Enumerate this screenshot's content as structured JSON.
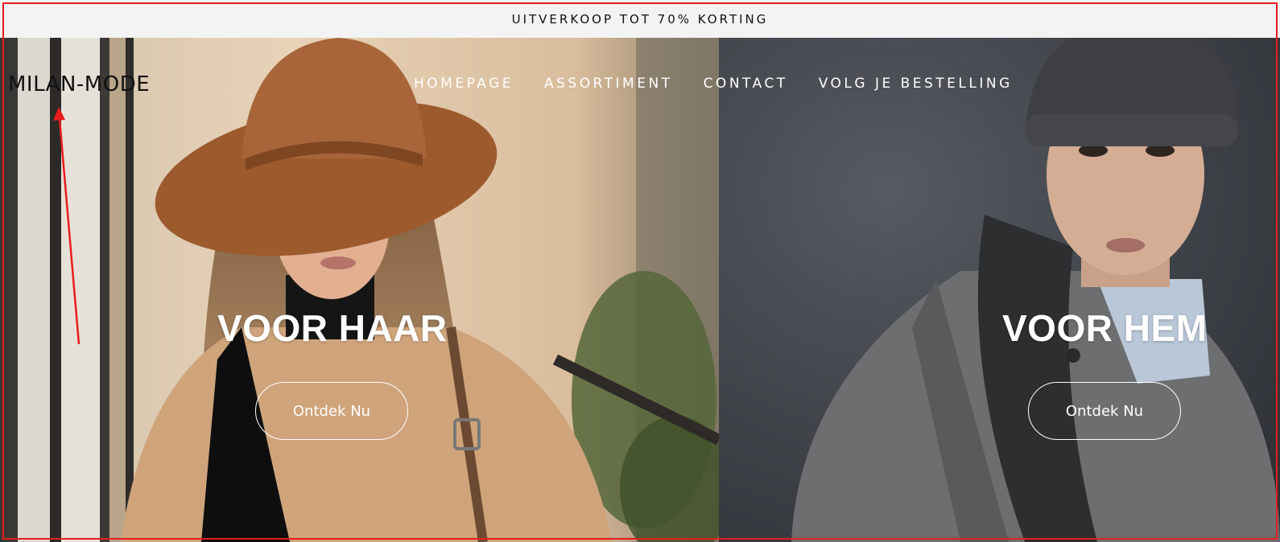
{
  "announcement": {
    "text": "UITVERKOOP TOT 70% KORTING"
  },
  "header": {
    "logo": "MILAN-MODE",
    "nav": [
      "HOMEPAGE",
      "ASSORTIMENT",
      "CONTACT",
      "VOLG JE BESTELLING"
    ]
  },
  "hero": {
    "left": {
      "title": "VOOR HAAR",
      "button": "Ontdek Nu"
    },
    "right": {
      "title": "VOOR HEM",
      "button": "Ontdek Nu"
    }
  },
  "colors": {
    "annotation": "#e81c1c",
    "announcement_bg": "#f3f3f3",
    "nav_text": "#ffffff",
    "logo_text": "#111111"
  }
}
